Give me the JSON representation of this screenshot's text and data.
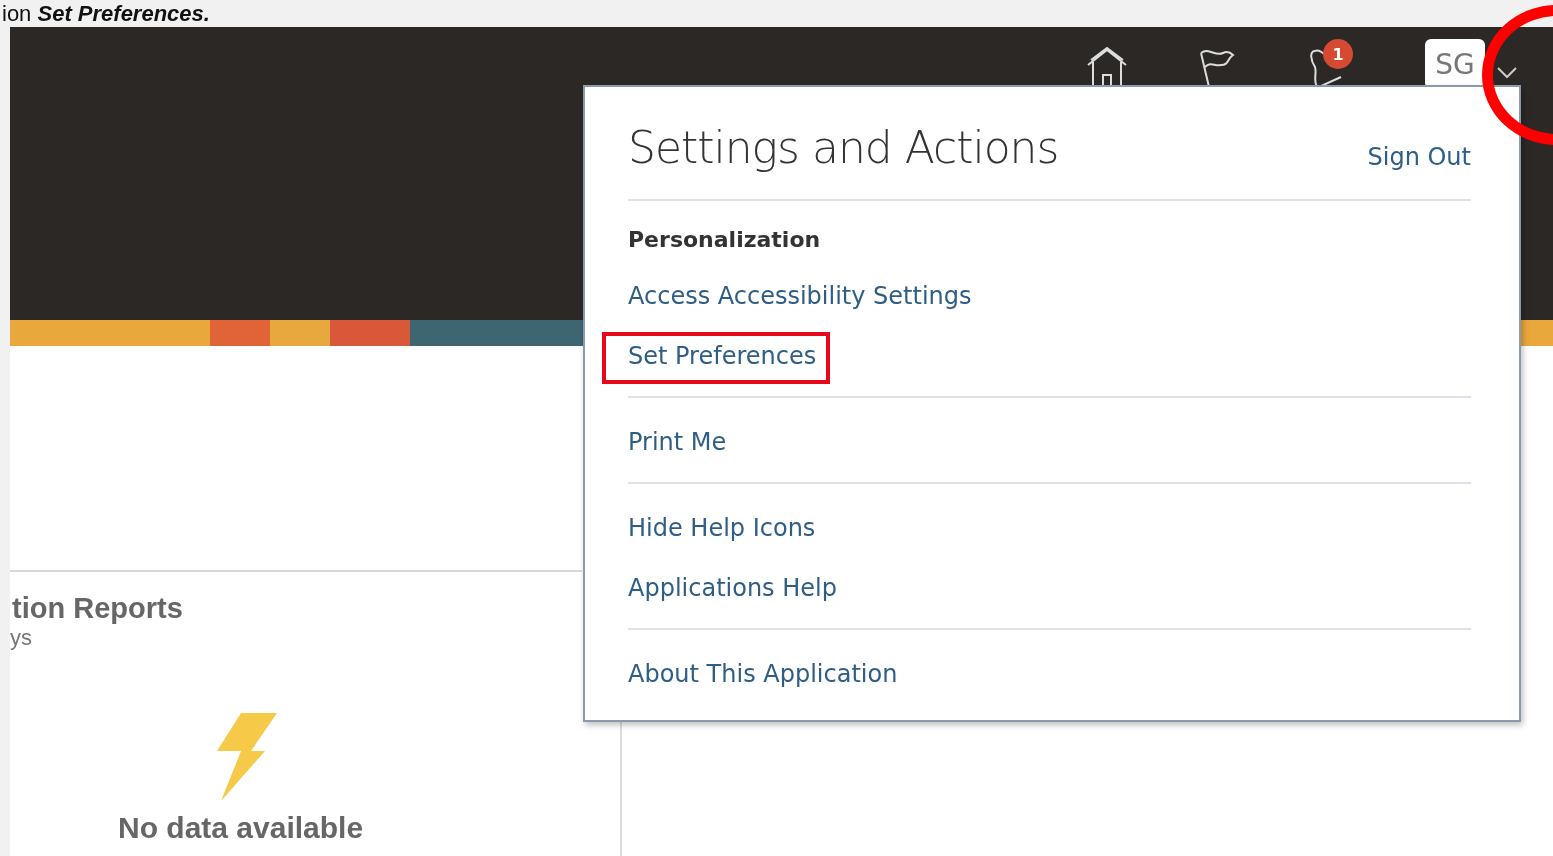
{
  "caption": "ion **Set Preferences.**",
  "header": {
    "notification_count": "1",
    "avatar_initials": "SG"
  },
  "panel": {
    "title": "tion Reports",
    "subtitle": "ys",
    "empty_message": "No data available"
  },
  "menu": {
    "title": "Settings and Actions",
    "sign_out": "Sign Out",
    "sections": [
      {
        "heading": "Personalization",
        "items": [
          {
            "label": "Access Accessibility Settings",
            "highlighted": false
          },
          {
            "label": "Set Preferences",
            "highlighted": true
          }
        ]
      },
      {
        "items": [
          {
            "label": "Print Me",
            "highlighted": false
          }
        ]
      },
      {
        "items": [
          {
            "label": "Hide Help Icons",
            "highlighted": false
          },
          {
            "label": "Applications Help",
            "highlighted": false
          }
        ]
      },
      {
        "items": [
          {
            "label": "About This Application",
            "highlighted": false
          }
        ]
      }
    ]
  }
}
